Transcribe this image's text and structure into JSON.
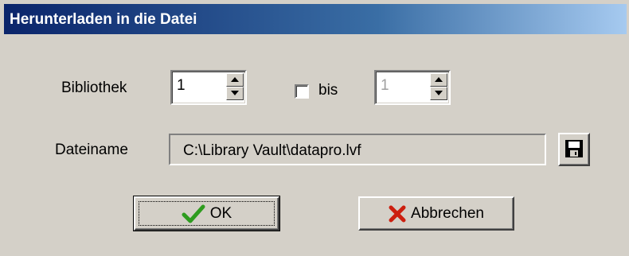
{
  "window": {
    "title": "Herunterladen in die Datei"
  },
  "library": {
    "label": "Bibliothek",
    "from_value": "1",
    "to_checkbox_label": "bis",
    "to_checked": false,
    "to_value": "1"
  },
  "file": {
    "label": "Dateiname",
    "path": "C:\\Library Vault\\datapro.lvf"
  },
  "buttons": {
    "ok_label": "OK",
    "cancel_label": "Abbrechen"
  },
  "icons": {
    "ok": "checkmark-icon",
    "cancel": "x-icon",
    "save": "floppy-disk-icon",
    "spin_up": "arrow-up-icon",
    "spin_down": "arrow-down-icon"
  },
  "colors": {
    "title_bar_start": "#0a246a",
    "title_bar_end": "#a6caf0",
    "dialog_bg": "#d4d0c8",
    "ok_check": "#2e9c1f",
    "cancel_x": "#cc1f0f"
  }
}
